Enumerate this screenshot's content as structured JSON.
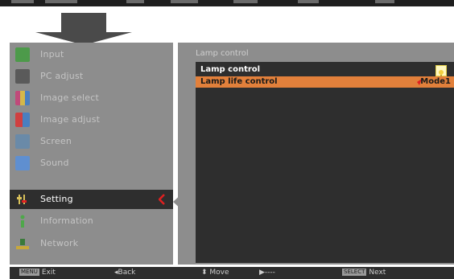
{
  "osd": {
    "menu": {
      "items": [
        {
          "label": "Input",
          "icon": "input-icon",
          "color": "#4d9a4a"
        },
        {
          "label": "PC adjust",
          "icon": "pc-adjust-icon",
          "color": "#5a5a5a"
        },
        {
          "label": "Image select",
          "icon": "image-select-icon",
          "color": "#c04a7a"
        },
        {
          "label": "Image adjust",
          "icon": "image-adjust-icon",
          "color": "#4a7fc0"
        },
        {
          "label": "Screen",
          "icon": "screen-icon",
          "color": "#6a8aa8"
        },
        {
          "label": "Sound",
          "icon": "sound-icon",
          "color": "#5f8fd0"
        },
        {
          "label": "Setting",
          "icon": "setting-icon",
          "color": "#d8c05a"
        },
        {
          "label": "Information",
          "icon": "information-icon",
          "color": "#4ea84a"
        },
        {
          "label": "Network",
          "icon": "network-icon",
          "color": "#c8a83a"
        }
      ],
      "active_index": 6
    },
    "submenu": {
      "title": "Lamp control",
      "rows": [
        {
          "label": "Lamp control",
          "value": ""
        },
        {
          "label": "Lamp life control",
          "value": "Mode1"
        }
      ],
      "selected_index": 1
    }
  },
  "bottom_bar": {
    "exit_key": "MENU",
    "exit": "Exit",
    "back": "Back",
    "move": "Move",
    "next": "----",
    "select_key": "SELECT",
    "select": "Next"
  },
  "colors": {
    "panel": "#8d8d8d",
    "dark": "#2e2e2e",
    "highlight": "#e2803b",
    "accent_red": "#e02020"
  }
}
